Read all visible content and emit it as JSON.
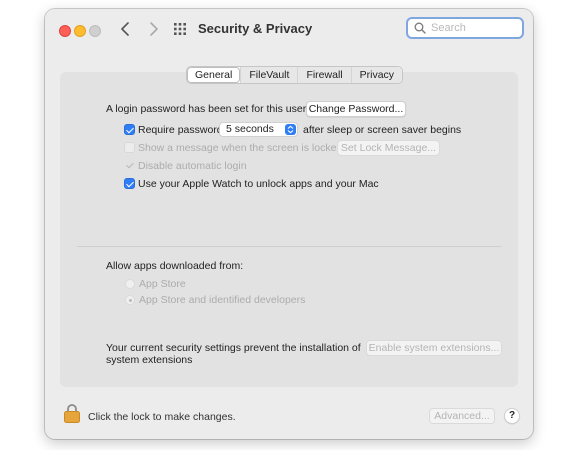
{
  "window": {
    "title": "Security & Privacy",
    "search_placeholder": "Search"
  },
  "tabs": [
    "General",
    "FileVault",
    "Firewall",
    "Privacy"
  ],
  "selected_tab": "General",
  "general": {
    "login_password_text": "A login password has been set for this user",
    "change_password_button": "Change Password...",
    "require_password": {
      "label": "Require password",
      "checked": true
    },
    "require_password_delay": "5 seconds",
    "after_sleep_text": "after sleep or screen saver begins",
    "show_message": {
      "label": "Show a message when the screen is locked",
      "checked": false,
      "disabled": true
    },
    "set_lock_message_button": "Set Lock Message...",
    "disable_auto_login": {
      "label": "Disable automatic login",
      "checked": true,
      "disabled": true
    },
    "apple_watch": {
      "label": "Use your Apple Watch to unlock apps and your Mac",
      "checked": true
    }
  },
  "downloads": {
    "heading": "Allow apps downloaded from:",
    "options": [
      {
        "label": "App Store",
        "selected": false
      },
      {
        "label": "App Store and identified developers",
        "selected": true
      }
    ]
  },
  "extensions": {
    "text_line1": "Your current security settings prevent the installation of",
    "text_line2": "system extensions",
    "button": "Enable system extensions..."
  },
  "footer": {
    "lock_text": "Click the lock to make changes.",
    "advanced_button": "Advanced...",
    "help_button": "?"
  },
  "icons": {
    "close": "close-light-icon",
    "minimize": "minimize-light-icon",
    "zoom": "zoom-light-icon",
    "back": "chevron-left-icon",
    "forward": "chevron-right-icon",
    "show_all": "grid-icon",
    "search": "search-icon",
    "lock": "lock-icon"
  },
  "colors": {
    "accent": "#2f7ef6",
    "close": "#fe5f57",
    "minimize": "#febc2e",
    "lock": "#e6a53b"
  }
}
